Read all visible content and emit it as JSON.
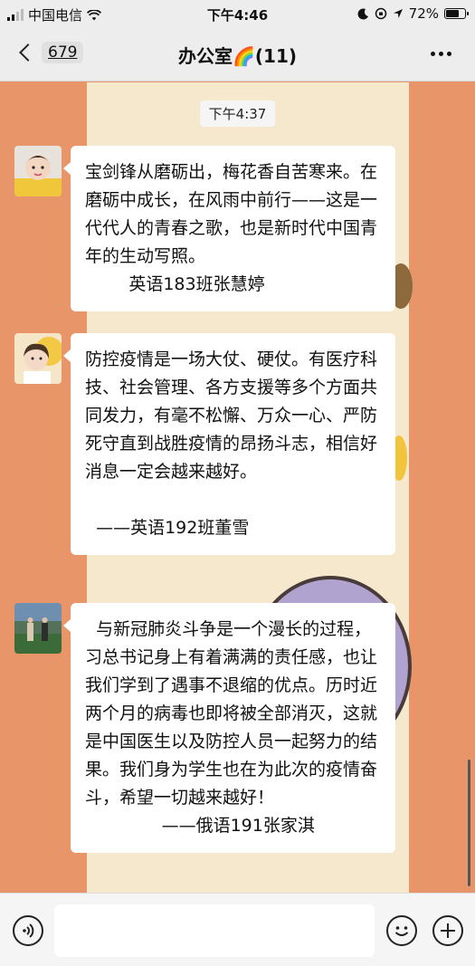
{
  "status_bar": {
    "carrier": "中国电信",
    "time": "下午4:46",
    "battery": "72%",
    "battery_level": 0.72
  },
  "nav": {
    "back_count": "679",
    "title": "办公室🌈(11)"
  },
  "chat": {
    "timestamp": "下午4:37",
    "messages": [
      {
        "text": "宝剑锋从磨砺出，梅花香自苦寒来。在磨砺中成长，在风雨中前行——这是一代代人的青春之歌，也是新时代中国青年的生动写照。\n        英语183班张慧婷"
      },
      {
        "text": "防控疫情是一场大仗、硬仗。有医疗科技、社会管理、各方支援等多个方面共同发力，有毫不松懈、万众一心、严防死守直到战胜疫情的昂扬斗志，相信好消息一定会越来越好。\n\n  ——英语192班董雪"
      },
      {
        "text": "  与新冠肺炎斗争是一个漫长的过程，习总书记身上有着满满的责任感，也让我们学到了遇事不退缩的优点。历时近两个月的病毒也即将被全部消灭，这就是中国医生以及防控人员一起努力的结果。我们身为学生也在为此次的疫情奋斗，希望一切越来越好！\n              ——俄语191张家淇"
      }
    ]
  },
  "input": {
    "value": ""
  },
  "colors": {
    "wallpaper_outer": "#e8956a",
    "wallpaper_inner": "#f6e8cc",
    "bar_bg": "#ededed"
  }
}
